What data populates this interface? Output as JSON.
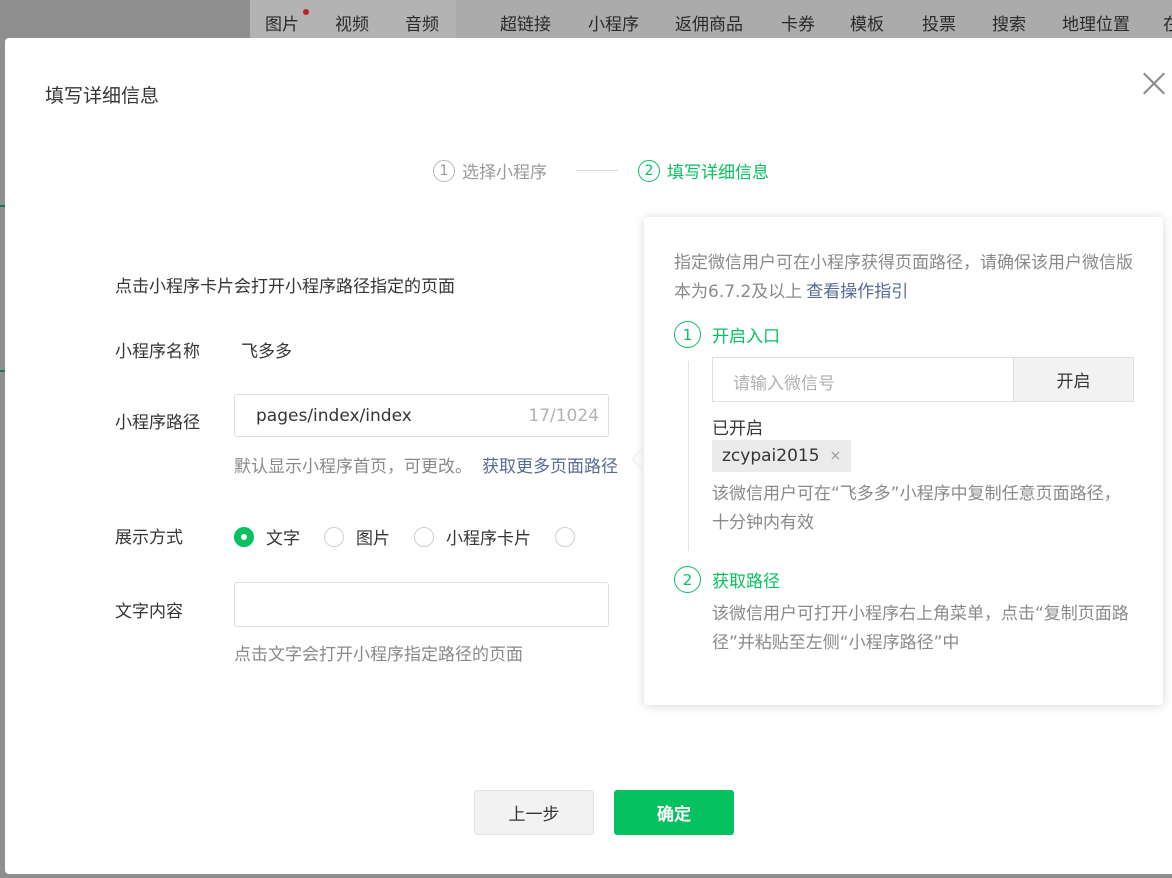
{
  "toolbar": {
    "items": [
      "图片",
      "视频",
      "音频",
      "超链接",
      "小程序",
      "返佣商品",
      "卡券",
      "模板",
      "投票",
      "搜索",
      "地理位置",
      "在"
    ]
  },
  "dialog": {
    "title": "填写详细信息",
    "steps": [
      {
        "num": "1",
        "label": "选择小程序"
      },
      {
        "num": "2",
        "label": "填写详细信息"
      }
    ],
    "description": "点击小程序卡片会打开小程序路径指定的页面",
    "name_label": "小程序名称",
    "name_value": "飞多多",
    "path_label": "小程序路径",
    "path_value": "pages/index/index",
    "path_counter": "17/1024",
    "path_hint": "默认显示小程序首页，可更改。",
    "path_link": "获取更多页面路径",
    "display_label": "展示方式",
    "display_options": [
      "文字",
      "图片",
      "小程序卡片"
    ],
    "display_selected": "文字",
    "text_label": "文字内容",
    "text_value": "",
    "text_hint": "点击文字会打开小程序指定路径的页面",
    "prev_button": "上一步",
    "ok_button": "确定"
  },
  "popover": {
    "intro": "指定微信用户可在小程序获得页面路径，请确保该用户微信版本为6.7.2及以上",
    "intro_link": "查看操作指引",
    "step1_num": "1",
    "step1_title": "开启入口",
    "wechat_placeholder": "请输入微信号",
    "open_button": "开启",
    "opened_label": "已开启",
    "opened_tag": "zcypai2015",
    "tag_close": "×",
    "step1_note": "该微信用户可在“飞多多”小程序中复制任意页面路径，十分钟内有效",
    "step2_num": "2",
    "step2_title": "获取路径",
    "step2_note": "该微信用户可打开小程序右上角菜单，点击“复制页面路径”并粘贴至左侧“小程序路径”中"
  },
  "colors": {
    "accent": "#07c160",
    "link": "#576b95",
    "muted": "#8a8a8a"
  }
}
